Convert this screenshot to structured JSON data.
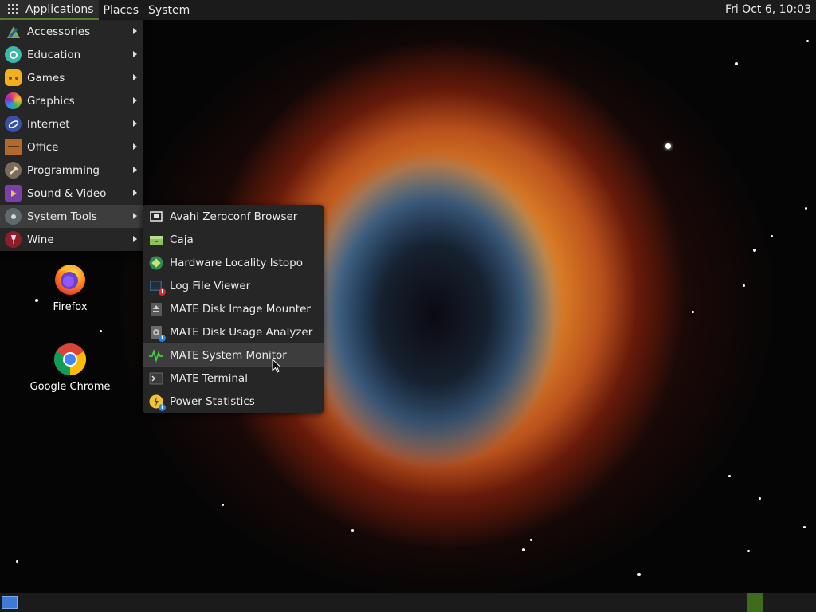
{
  "top_panel": {
    "applications": "Applications",
    "places": "Places",
    "system": "System",
    "clock": "Fri Oct  6, 10:03"
  },
  "main_menu": {
    "items": [
      {
        "label": "Accessories",
        "icon": "accessories-icon"
      },
      {
        "label": "Education",
        "icon": "education-icon"
      },
      {
        "label": "Games",
        "icon": "games-icon"
      },
      {
        "label": "Graphics",
        "icon": "graphics-icon"
      },
      {
        "label": "Internet",
        "icon": "internet-icon"
      },
      {
        "label": "Office",
        "icon": "office-icon"
      },
      {
        "label": "Programming",
        "icon": "programming-icon"
      },
      {
        "label": "Sound & Video",
        "icon": "sound-video-icon"
      },
      {
        "label": "System Tools",
        "icon": "system-tools-icon"
      },
      {
        "label": "Wine",
        "icon": "wine-icon"
      }
    ],
    "active_item": "System Tools"
  },
  "system_tools_menu": {
    "items": [
      {
        "label": "Avahi Zeroconf Browser",
        "icon": "network-browser-icon"
      },
      {
        "label": "Caja",
        "icon": "file-manager-icon"
      },
      {
        "label": "Hardware Locality lstopo",
        "icon": "hardware-locality-icon"
      },
      {
        "label": "Log File Viewer",
        "icon": "log-viewer-icon"
      },
      {
        "label": "MATE Disk Image Mounter",
        "icon": "disk-mounter-icon"
      },
      {
        "label": "MATE Disk Usage Analyzer",
        "icon": "disk-usage-icon"
      },
      {
        "label": "MATE System Monitor",
        "icon": "system-monitor-icon"
      },
      {
        "label": "MATE Terminal",
        "icon": "terminal-icon"
      },
      {
        "label": "Power Statistics",
        "icon": "power-statistics-icon"
      }
    ],
    "hovered_item": "MATE System Monitor"
  },
  "desktop_icons": [
    {
      "label": "Firefox",
      "icon": "firefox-icon"
    },
    {
      "label": "Google Chrome",
      "icon": "chrome-icon"
    }
  ],
  "colors": {
    "panel_bg": "#1b1b1b",
    "menu_bg": "#262626",
    "highlight": "#3d3d3d",
    "accent_green": "#5f8b33"
  }
}
